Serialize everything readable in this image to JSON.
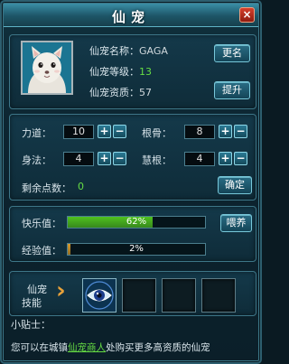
{
  "window": {
    "title": "仙宠",
    "close_label": "×"
  },
  "pet": {
    "name_label": "仙宠名称：",
    "name_value": "GAGA",
    "level_label": "仙宠等级：",
    "level_value": "13",
    "quality_label": "仙宠资质：",
    "quality_value": "57",
    "rename_button": "更名",
    "upgrade_button": "提升"
  },
  "stats": {
    "strength": {
      "label": "力道：",
      "value": "10"
    },
    "root": {
      "label": "根骨：",
      "value": "8"
    },
    "agility": {
      "label": "身法：",
      "value": "4"
    },
    "wisdom": {
      "label": "慧根：",
      "value": "4"
    },
    "remaining_label": "剩余点数：",
    "remaining_value": "0",
    "confirm_button": "确定",
    "plus": "+",
    "minus": "−"
  },
  "bars": {
    "happiness": {
      "label": "快乐值：",
      "percent": 62,
      "text": "62%",
      "color": "#4fc21e"
    },
    "experience": {
      "label": "经验值：",
      "percent": 2,
      "text": "2%",
      "color": "#d89a2a"
    },
    "feed_button": "喂养"
  },
  "skills": {
    "label_line1": "仙宠",
    "label_line2": "技能",
    "arrow": "›"
  },
  "tip": {
    "title": "小贴士：",
    "text_before": "您可以在城镇",
    "link": "仙宠商人",
    "text_after": "处购买更多高资质的仙宠"
  }
}
